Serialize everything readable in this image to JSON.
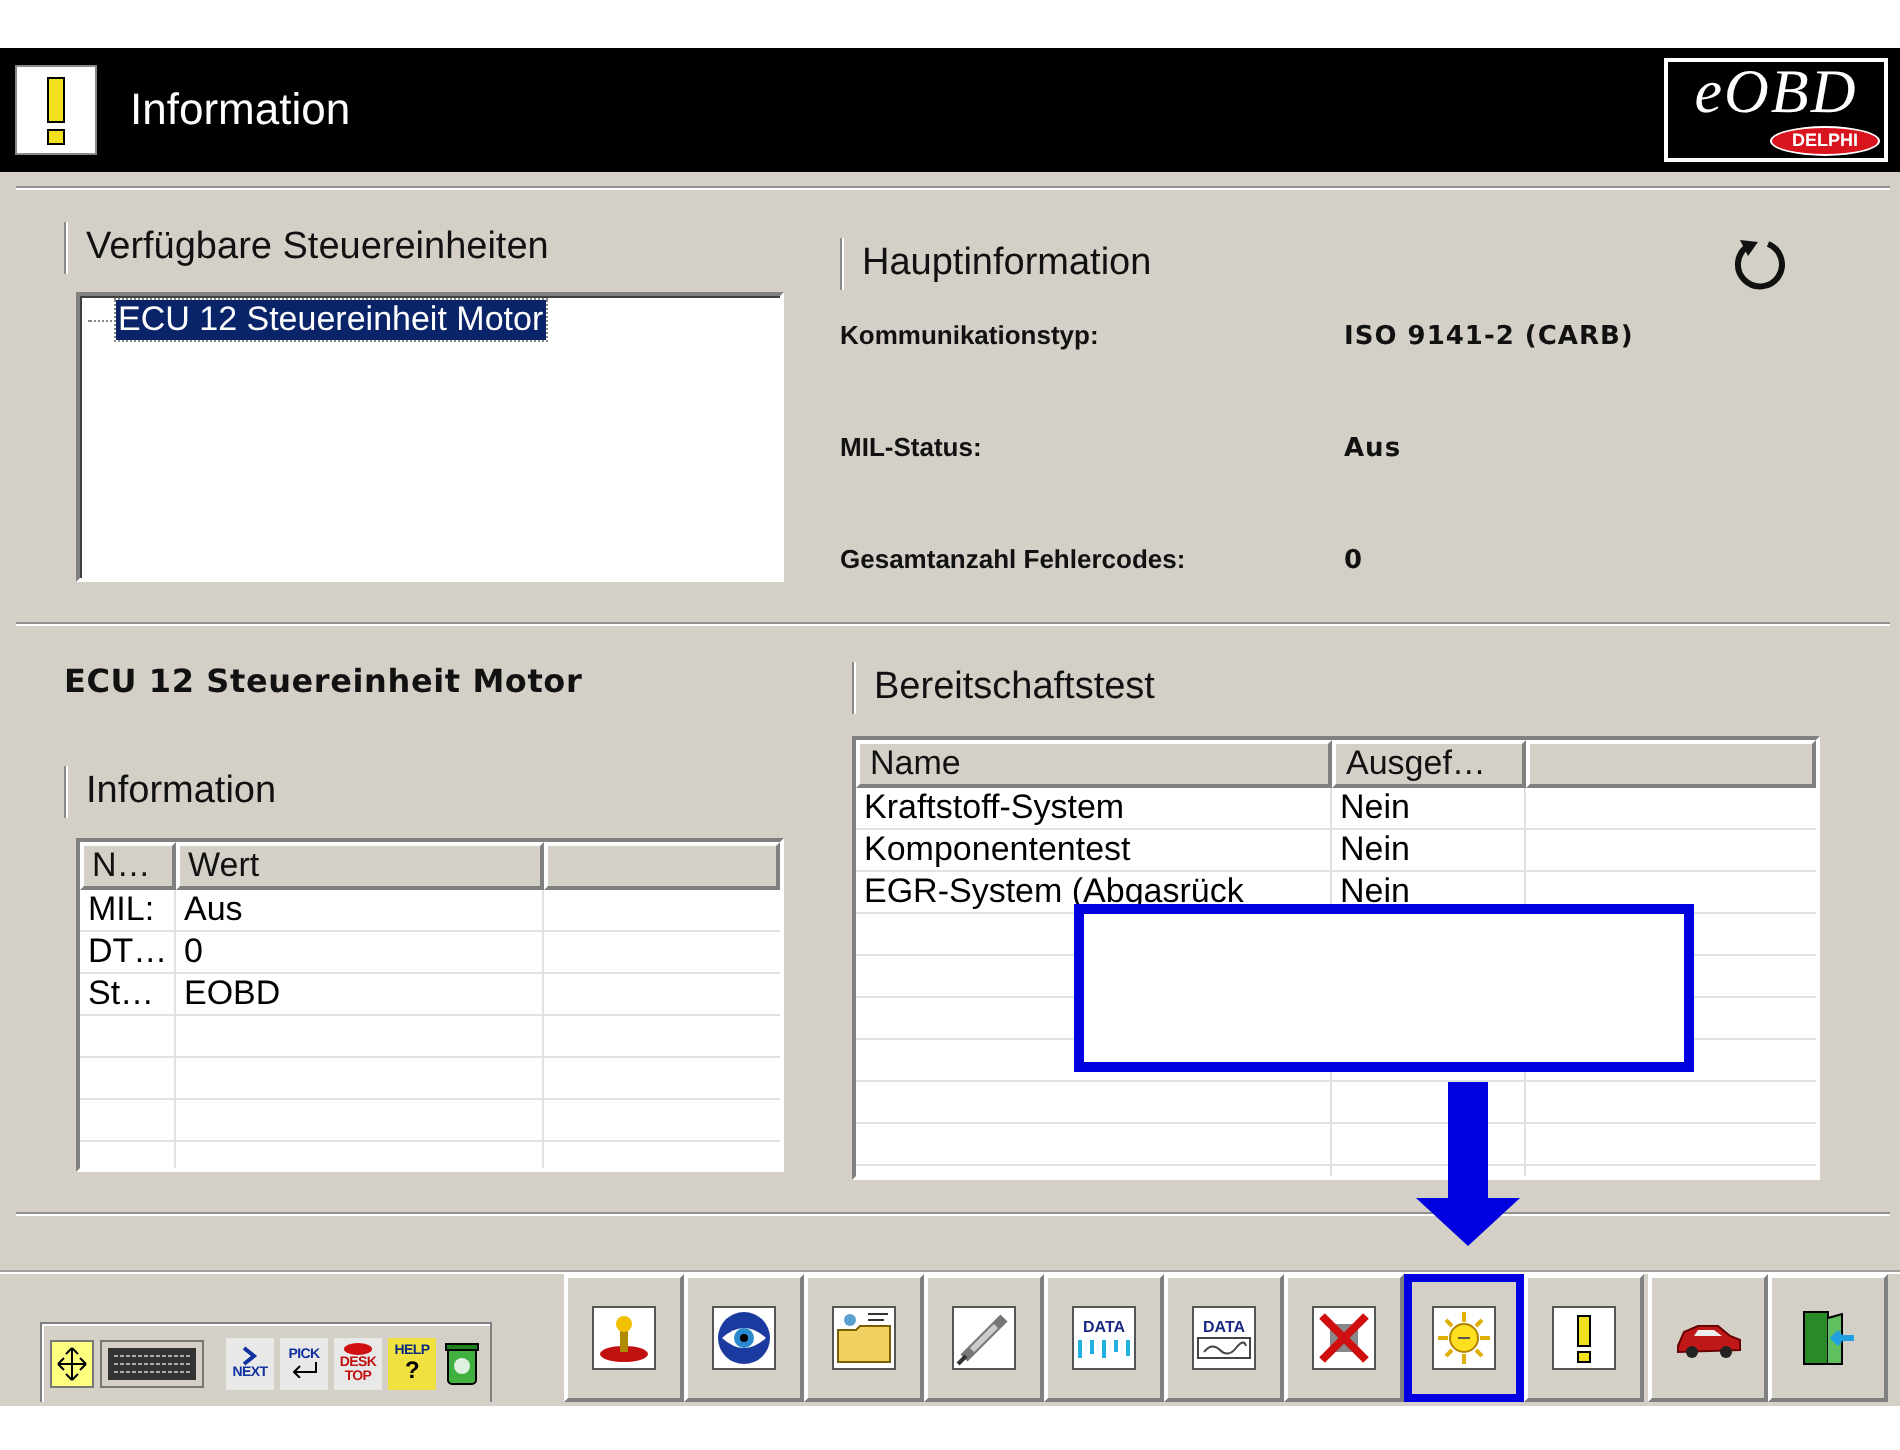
{
  "header": {
    "title": "Information",
    "logo": {
      "name": "eOBD",
      "badge": "DELPHI"
    }
  },
  "units": {
    "title": "Verfügbare Steuereinheiten",
    "items": [
      {
        "label": "ECU 12 Steuereinheit Motor",
        "selected": true
      }
    ]
  },
  "main_info": {
    "title": "Hauptinformation",
    "rows": [
      {
        "label": "Kommunikationstyp:",
        "value": "ISO 9141-2 (CARB)"
      },
      {
        "label": "MIL-Status:",
        "value": "Aus"
      },
      {
        "label": "Gesamtanzahl Fehlercodes:",
        "value": "0"
      }
    ]
  },
  "unit_name": "ECU 12 Steuereinheit Motor",
  "info_table": {
    "title": "Information",
    "columns": [
      "N…",
      "Wert"
    ],
    "rows": [
      [
        "MIL:",
        "Aus"
      ],
      [
        "DT…",
        "0"
      ],
      [
        "St…",
        "EOBD"
      ]
    ]
  },
  "readiness": {
    "title": "Bereitschaftstest",
    "columns": [
      "Name",
      "Ausgef…"
    ],
    "rows": [
      [
        "Kraftstoff-System",
        "Nein"
      ],
      [
        "Komponententest",
        "Nein"
      ],
      [
        "EGR-System (Abgasrück",
        "Nein"
      ]
    ]
  },
  "quick_bar": [
    {
      "kind": "move"
    },
    {
      "kind": "keyboard"
    },
    {
      "kind": "next",
      "label": "NEXT"
    },
    {
      "kind": "pick",
      "label": "PICK"
    },
    {
      "kind": "desktop",
      "label": "DESK TOP"
    },
    {
      "kind": "help",
      "label": "HELP",
      "glyph": "?"
    },
    {
      "kind": "trash"
    }
  ],
  "toolbar": [
    {
      "kind": "joystick",
      "highlighted": false
    },
    {
      "kind": "eye",
      "highlighted": false
    },
    {
      "kind": "folder",
      "highlighted": false
    },
    {
      "kind": "plug",
      "highlighted": false
    },
    {
      "kind": "data",
      "label": "DATA",
      "highlighted": false
    },
    {
      "kind": "data_sheet",
      "label": "DATA",
      "highlighted": false
    },
    {
      "kind": "crossed",
      "highlighted": false
    },
    {
      "kind": "sun",
      "highlighted": true
    },
    {
      "kind": "exclamation",
      "highlighted": false
    },
    {
      "kind": "car",
      "highlighted": false
    },
    {
      "kind": "exit",
      "highlighted": false
    }
  ]
}
